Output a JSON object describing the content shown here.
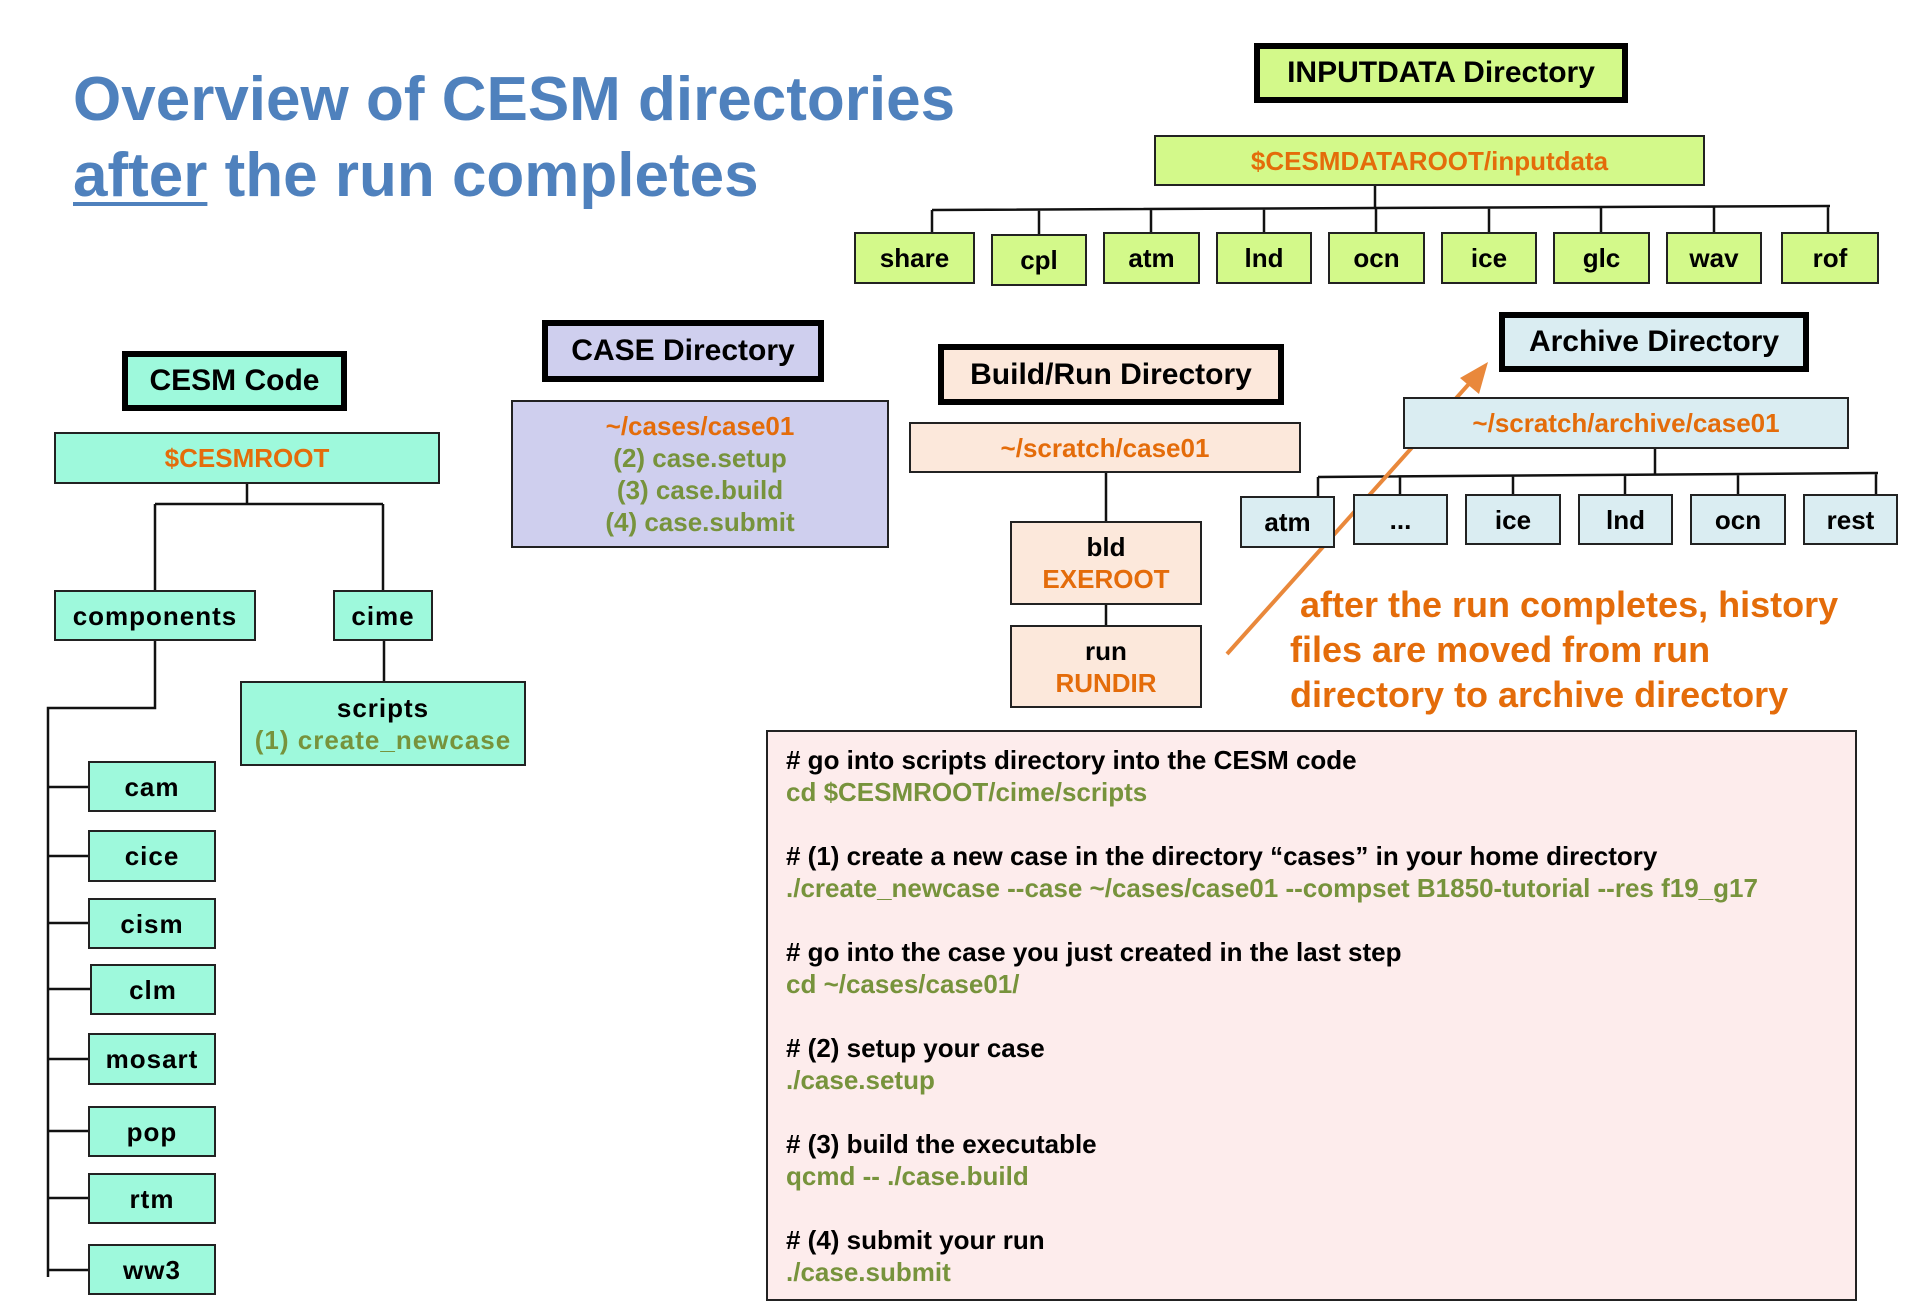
{
  "title": {
    "line1": "Overview of CESM directories",
    "line2_underlined": "after",
    "line2_rest": " the run completes"
  },
  "colors": {
    "title": "#4F81BD",
    "path": "#E46C0A",
    "command": "#77933C",
    "arrow": "#E9883B",
    "inputdata": "#D3F98A",
    "code": "#9EF9DC",
    "case": "#CFCFEE",
    "buildrun": "#FCE8DB",
    "archive": "#DAEDF2",
    "code_panel": "#FDECEC"
  },
  "inputdata": {
    "header": "INPUTDATA Directory",
    "path": "$CESMDATAROOT/inputdata",
    "children": [
      "share",
      "cpl",
      "atm",
      "lnd",
      "ocn",
      "ice",
      "glc",
      "wav",
      "rof"
    ]
  },
  "cesm_code": {
    "header": "CESM Code",
    "path": "$CESMROOT",
    "components": "components",
    "cime": "cime",
    "scripts": "scripts",
    "scripts_step": "(1) create_newcase",
    "component_list": [
      "cam",
      "cice",
      "cism",
      "clm",
      "mosart",
      "pop",
      "rtm",
      "ww3"
    ]
  },
  "case": {
    "header": "CASE Directory",
    "path": "~/cases/case01",
    "steps": [
      "(2) case.setup",
      "(3) case.build",
      "(4) case.submit"
    ]
  },
  "buildrun": {
    "header": "Build/Run Directory",
    "path": "~/scratch/case01",
    "bld": "bld",
    "bld_var": "EXEROOT",
    "run": "run",
    "run_var": "RUNDIR"
  },
  "archive": {
    "header": "Archive Directory",
    "path": "~/scratch/archive/case01",
    "children": [
      "atm",
      "...",
      "ice",
      "lnd",
      "ocn",
      "rest"
    ]
  },
  "note": [
    "after the run completes, history",
    "files are moved from run",
    "directory to archive directory"
  ],
  "code": [
    {
      "comment": "# go into scripts directory into the CESM code",
      "command": "cd $CESMROOT/cime/scripts"
    },
    {
      "comment": "# (1) create a new case in the directory “cases” in your home directory",
      "command": "./create_newcase --case ~/cases/case01 --compset B1850-tutorial --res f19_g17"
    },
    {
      "comment": "# go into the case you just created in the last step",
      "command": "cd ~/cases/case01/"
    },
    {
      "comment": "# (2) setup your case",
      "command": "./case.setup"
    },
    {
      "comment": "# (3) build the executable",
      "command": "qcmd -- ./case.build"
    },
    {
      "comment": "# (4) submit your run",
      "command": "./case.submit"
    }
  ]
}
